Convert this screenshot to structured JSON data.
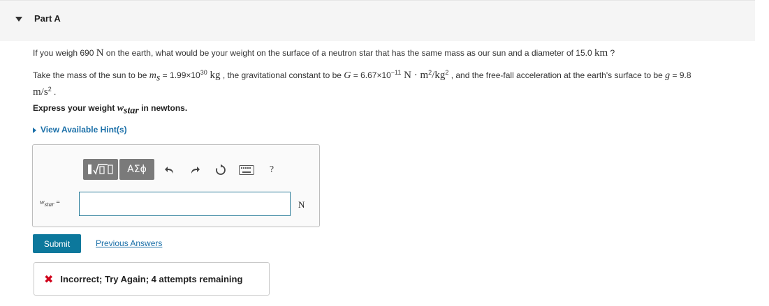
{
  "part": {
    "title": "Part A"
  },
  "question": {
    "line1_a": "If you weigh 690 ",
    "line1_N": "N",
    "line1_b": " on the earth, what would be your weight on the surface of a neutron star that has the same mass as our sun and a diameter of 15.0 ",
    "line1_km": "km",
    "line1_c": " ?",
    "line2_a": "Take the mass of the sun to be ",
    "line2_m": "m",
    "line2_s": "s",
    "line2_b": " = 1.99×10",
    "line2_exp30": "30",
    "line2_kg": " kg",
    "line2_c": " , the gravitational constant to be ",
    "line2_G": "G",
    "line2_d": " = 6.67×10",
    "line2_expm11": "−11",
    "line2_units": " N · m",
    "line2_sq1": "2",
    "line2_kg2": "/kg",
    "line2_sq2": "2",
    "line2_e": " , and the free-fall acceleration at the earth's surface to be ",
    "line2_g": "g",
    "line2_f": " = 9.8",
    "line3_ms": "m/s",
    "line3_sq": "2",
    "line3_dot": " .",
    "line4_a": "Express your weight ",
    "line4_w": "w",
    "line4_star": "star",
    "line4_b": " in newtons."
  },
  "hint": {
    "label": "View Available Hint(s)"
  },
  "toolbar": {
    "greek_label": "ΑΣϕ",
    "icons": [
      "templates-icon",
      "greek-symbols-icon",
      "undo-icon",
      "redo-icon",
      "reset-icon",
      "keyboard-icon",
      "help-icon"
    ],
    "help_label": "?"
  },
  "answer": {
    "label_w": "w",
    "label_star": "star",
    "label_eq": " =",
    "value": "",
    "unit": "N"
  },
  "submit_label": "Submit",
  "previous_answers_label": "Previous Answers",
  "feedback": {
    "icon": "✖",
    "text": "Incorrect; Try Again; 4 attempts remaining"
  },
  "colors": {
    "accent": "#0c789c",
    "link": "#1a6fa8",
    "error": "#d0021b",
    "toolbar": "#7a7a7a"
  }
}
